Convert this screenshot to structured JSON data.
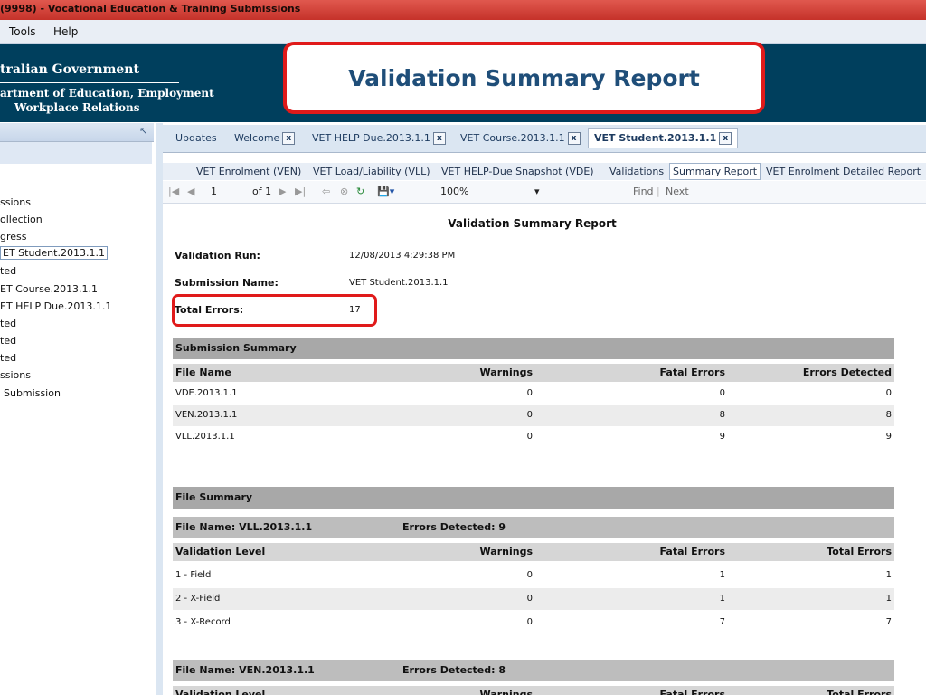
{
  "window": {
    "title": "(9998) - Vocational Education & Training Submissions"
  },
  "menu": {
    "items": [
      "Tools",
      "Help"
    ]
  },
  "banner": {
    "gov_line1": "tralian Government",
    "gov_line2": "artment of Education, Employment",
    "gov_line3": "Workplace Relations",
    "callout": "Validation Summary Report"
  },
  "tree": {
    "items": [
      "ssions",
      "ollection",
      "gress",
      "ET Student.2013.1.1",
      "ted",
      "ET Course.2013.1.1",
      "ET HELP Due.2013.1.1",
      "ted",
      "ted",
      "ted",
      "ssions",
      "Submission"
    ]
  },
  "doc_tabs": [
    "Updates",
    "Welcome",
    "VET HELP Due.2013.1.1",
    "VET Course.2013.1.1",
    "VET Student.2013.1.1"
  ],
  "sub_tabs": [
    "VET Enrolment (VEN)",
    "VET Load/Liability (VLL)",
    "VET HELP-Due Snapshot (VDE)",
    "Validations",
    "Summary Report",
    "VET Enrolment Detailed Report"
  ],
  "toolbar": {
    "page": "1",
    "of": "of 1",
    "zoom": "100%",
    "find": "Find",
    "next": "Next"
  },
  "report": {
    "title": "Validation Summary Report",
    "run_label": "Validation Run:",
    "run_value": "12/08/2013 4:29:38 PM",
    "name_label": "Submission Name:",
    "name_value": "VET Student.2013.1.1",
    "errors_label": "Total Errors:",
    "errors_value": "17",
    "submission_summary": {
      "title": "Submission Summary",
      "headers": [
        "File Name",
        "Warnings",
        "Fatal Errors",
        "Errors Detected"
      ],
      "rows": [
        [
          "VDE.2013.1.1",
          "0",
          "0",
          "0"
        ],
        [
          "VEN.2013.1.1",
          "0",
          "8",
          "8"
        ],
        [
          "VLL.2013.1.1",
          "0",
          "9",
          "9"
        ]
      ]
    },
    "file_summary": {
      "title": "File Summary",
      "vll": {
        "file": "File Name: VLL.2013.1.1",
        "detected": "Errors Detected: 9"
      },
      "headers": [
        "Validation Level",
        "Warnings",
        "Fatal Errors",
        "Total Errors"
      ],
      "rows": [
        [
          "1 - Field",
          "0",
          "1",
          "1"
        ],
        [
          "2 - X-Field",
          "0",
          "1",
          "1"
        ],
        [
          "3 - X-Record",
          "0",
          "7",
          "7"
        ]
      ],
      "ven": {
        "file": "File Name: VEN.2013.1.1",
        "detected": "Errors Detected: 8"
      },
      "ven_headers": [
        "Validation Level",
        "Warnings",
        "Fatal Errors",
        "Total Errors"
      ]
    }
  }
}
